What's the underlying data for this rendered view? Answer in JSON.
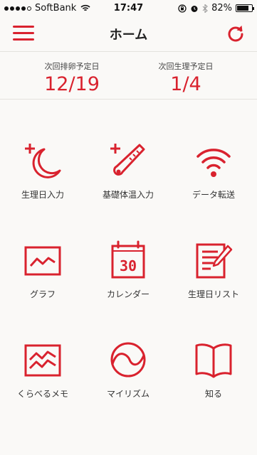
{
  "status_bar": {
    "carrier": "SoftBank",
    "time": "17:47",
    "battery": "82%",
    "battery_level": 0.82
  },
  "nav": {
    "title": "ホーム",
    "menu_icon": "hamburger-menu-icon",
    "refresh_icon": "refresh-icon"
  },
  "summary": {
    "ovulation_label": "次回排卵予定日",
    "ovulation_date": "12/19",
    "period_label": "次回生理予定日",
    "period_date": "1/4"
  },
  "menu": {
    "items": [
      {
        "label": "生理日入力",
        "icon": "moon-plus-icon"
      },
      {
        "label": "基礎体温入力",
        "icon": "thermometer-plus-icon"
      },
      {
        "label": "データ転送",
        "icon": "wifi-icon"
      },
      {
        "label": "グラフ",
        "icon": "graph-icon"
      },
      {
        "label": "カレンダー",
        "icon": "calendar-icon"
      },
      {
        "label": "生理日リスト",
        "icon": "list-icon"
      },
      {
        "label": "くらべるメモ",
        "icon": "compare-graph-icon"
      },
      {
        "label": "マイリズム",
        "icon": "rhythm-icon"
      },
      {
        "label": "知る",
        "icon": "book-icon"
      }
    ],
    "calendar_day": "30"
  },
  "colors": {
    "accent": "#d9222e",
    "background": "#faf9f7"
  }
}
